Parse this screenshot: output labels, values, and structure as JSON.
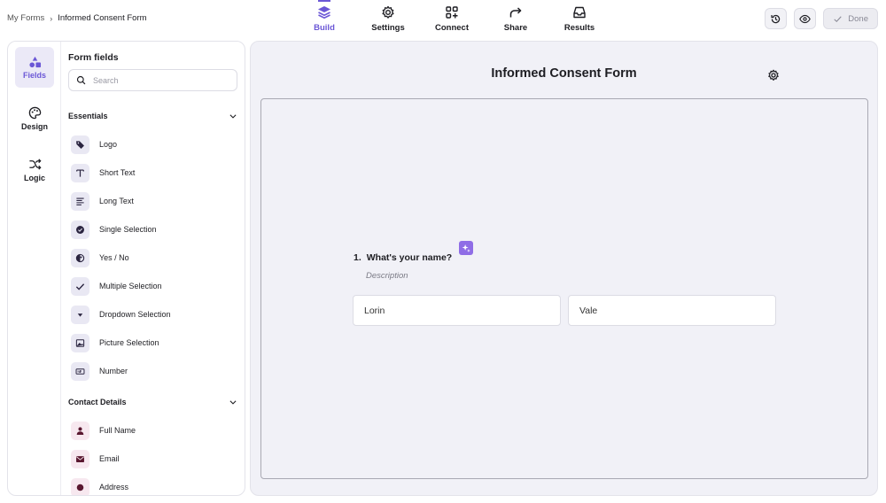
{
  "breadcrumb": {
    "root": "My Forms",
    "current": "Informed Consent Form"
  },
  "nav": [
    {
      "label": "Build",
      "icon": "layers-icon",
      "active": true
    },
    {
      "label": "Settings",
      "icon": "gear-icon",
      "active": false
    },
    {
      "label": "Connect",
      "icon": "integrations-icon",
      "active": false
    },
    {
      "label": "Share",
      "icon": "share-icon",
      "active": false
    },
    {
      "label": "Results",
      "icon": "inbox-icon",
      "active": false
    }
  ],
  "actions": {
    "done_label": "Done"
  },
  "rail": [
    {
      "label": "Fields",
      "icon": "shapes-icon",
      "active": true
    },
    {
      "label": "Design",
      "icon": "palette-icon",
      "active": false
    },
    {
      "label": "Logic",
      "icon": "shuffle-icon",
      "active": false
    }
  ],
  "fields_panel": {
    "title": "Form fields",
    "search_placeholder": "Search",
    "essentials_title": "Essentials",
    "essentials": [
      "Logo",
      "Short Text",
      "Long Text",
      "Single Selection",
      "Yes / No",
      "Multiple Selection",
      "Dropdown Selection",
      "Picture Selection",
      "Number"
    ],
    "contact_title": "Contact Details",
    "contact": [
      "Full Name",
      "Email",
      "Address"
    ]
  },
  "form": {
    "title": "Informed Consent Form",
    "question_number": "1.",
    "question_text": "What's your name?",
    "description_placeholder": "Description",
    "first_name": "Lorin",
    "last_name": "Vale"
  },
  "colors": {
    "accent": "#6b57d6",
    "contact_icon": "#5a1830",
    "ai_button": "#8f6de6"
  }
}
